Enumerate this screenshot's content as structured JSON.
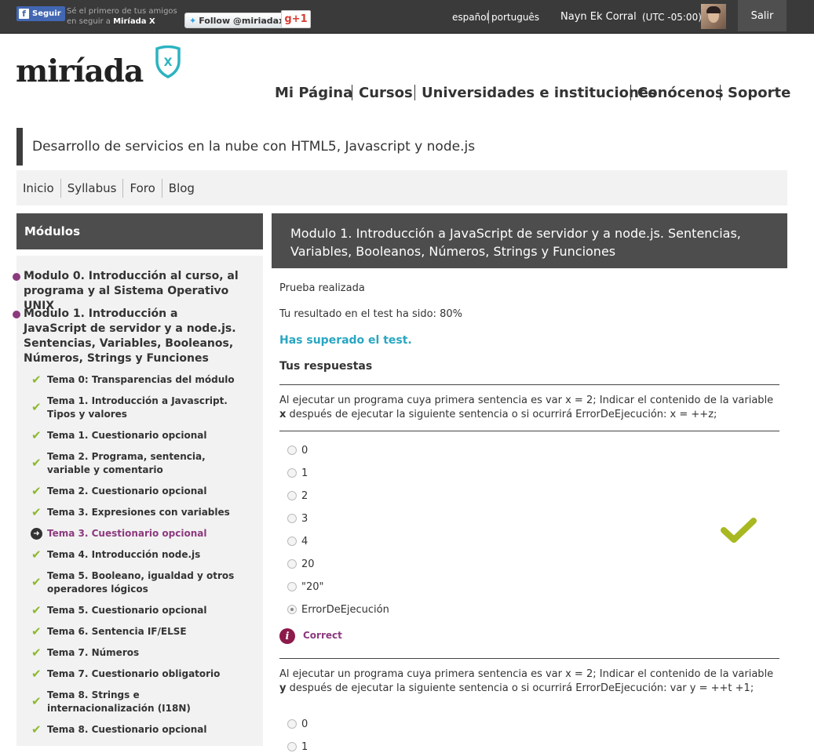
{
  "topbar": {
    "fb_label": "Seguir",
    "fb_text_line1": "Sé el primero de tus amigos",
    "fb_text_line2_prefix": "en seguir a",
    "fb_text_line2_brand": "Miríada X",
    "twitter_label": "Follow @miriadax",
    "gplus_label": "g+1",
    "lang_es": "español",
    "lang_pt": "português",
    "user_name": "Nayn Ek Corral",
    "timezone": "(UTC -05:00)",
    "logout_label": "Salir"
  },
  "brand": {
    "logo_text": "miríada",
    "logo_badge": "X",
    "accent_color": "#2bb3c0"
  },
  "main_nav": [
    "Mi Página",
    "Cursos",
    "Universidades e instituciones",
    "Conócenos",
    "Soporte"
  ],
  "course": {
    "title": "Desarrollo de servicios en la nube con HTML5, Javascript y node.js",
    "nav": [
      "Inicio",
      "Syllabus",
      "Foro",
      "Blog"
    ]
  },
  "sidebar": {
    "heading": "Módulos",
    "modules": [
      "Modulo 0. Introducción al curso, al programa y al Sistema Operativo UNIX",
      "Modulo 1. Introducción a JavaScript de servidor y a node.js. Sentencias, Variables, Booleanos, Números, Strings y Funciones"
    ],
    "temas": [
      {
        "label": "Tema 0: Transparencias del módulo",
        "status": "done"
      },
      {
        "label": "Tema 1. Introducción a Javascript. Tipos y valores",
        "status": "done"
      },
      {
        "label": "Tema 1. Cuestionario opcional",
        "status": "done"
      },
      {
        "label": "Tema 2. Programa, sentencia, variable y comentario",
        "status": "done"
      },
      {
        "label": "Tema 2. Cuestionario opcional",
        "status": "done"
      },
      {
        "label": "Tema 3. Expresiones con variables",
        "status": "done"
      },
      {
        "label": "Tema 3. Cuestionario opcional",
        "status": "current"
      },
      {
        "label": "Tema 4. Introducción node.js",
        "status": "done"
      },
      {
        "label": "Tema 5. Booleano, igualdad y otros operadores lógicos",
        "status": "done"
      },
      {
        "label": "Tema 5. Cuestionario opcional",
        "status": "done"
      },
      {
        "label": "Tema 6. Sentencia IF/ELSE",
        "status": "done"
      },
      {
        "label": "Tema 7. Números",
        "status": "done"
      },
      {
        "label": "Tema 7. Cuestionario obligatorio",
        "status": "done"
      },
      {
        "label": "Tema 8. Strings e internacionalización (I18N)",
        "status": "done"
      },
      {
        "label": "Tema 8. Cuestionario opcional",
        "status": "done"
      }
    ]
  },
  "main": {
    "heading": "Modulo 1. Introducción a JavaScript de servidor y a node.js. Sentencias, Variables, Booleanos, Números, Strings y Funciones",
    "status": "Prueba realizada",
    "result": "Tu resultado en el test ha sido: 80%",
    "passed": "Has superado el test.",
    "answers_heading": "Tus respuestas",
    "q1": {
      "text_before": "Al ejecutar un programa cuya primera sentencia es var x = 2; Indicar el contenido de la variable ",
      "var": "x",
      "text_after": " después de ejecutar la siguiente sentencia o si ocurrirá ErrorDeEjecución: x = ++z;",
      "options": [
        "0",
        "1",
        "2",
        "3",
        "4",
        "20",
        "\"20\"",
        "ErrorDeEjecución"
      ],
      "selected_index": 7,
      "feedback": "Correct"
    },
    "q2": {
      "text_before": "Al ejecutar un programa cuya primera sentencia es var x = 2; Indicar el contenido de la variable ",
      "var": "y",
      "text_after": " después de ejecutar la siguiente sentencia o si ocurrirá ErrorDeEjecución: var y = ++t +1;",
      "options": [
        "0",
        "1"
      ]
    }
  }
}
